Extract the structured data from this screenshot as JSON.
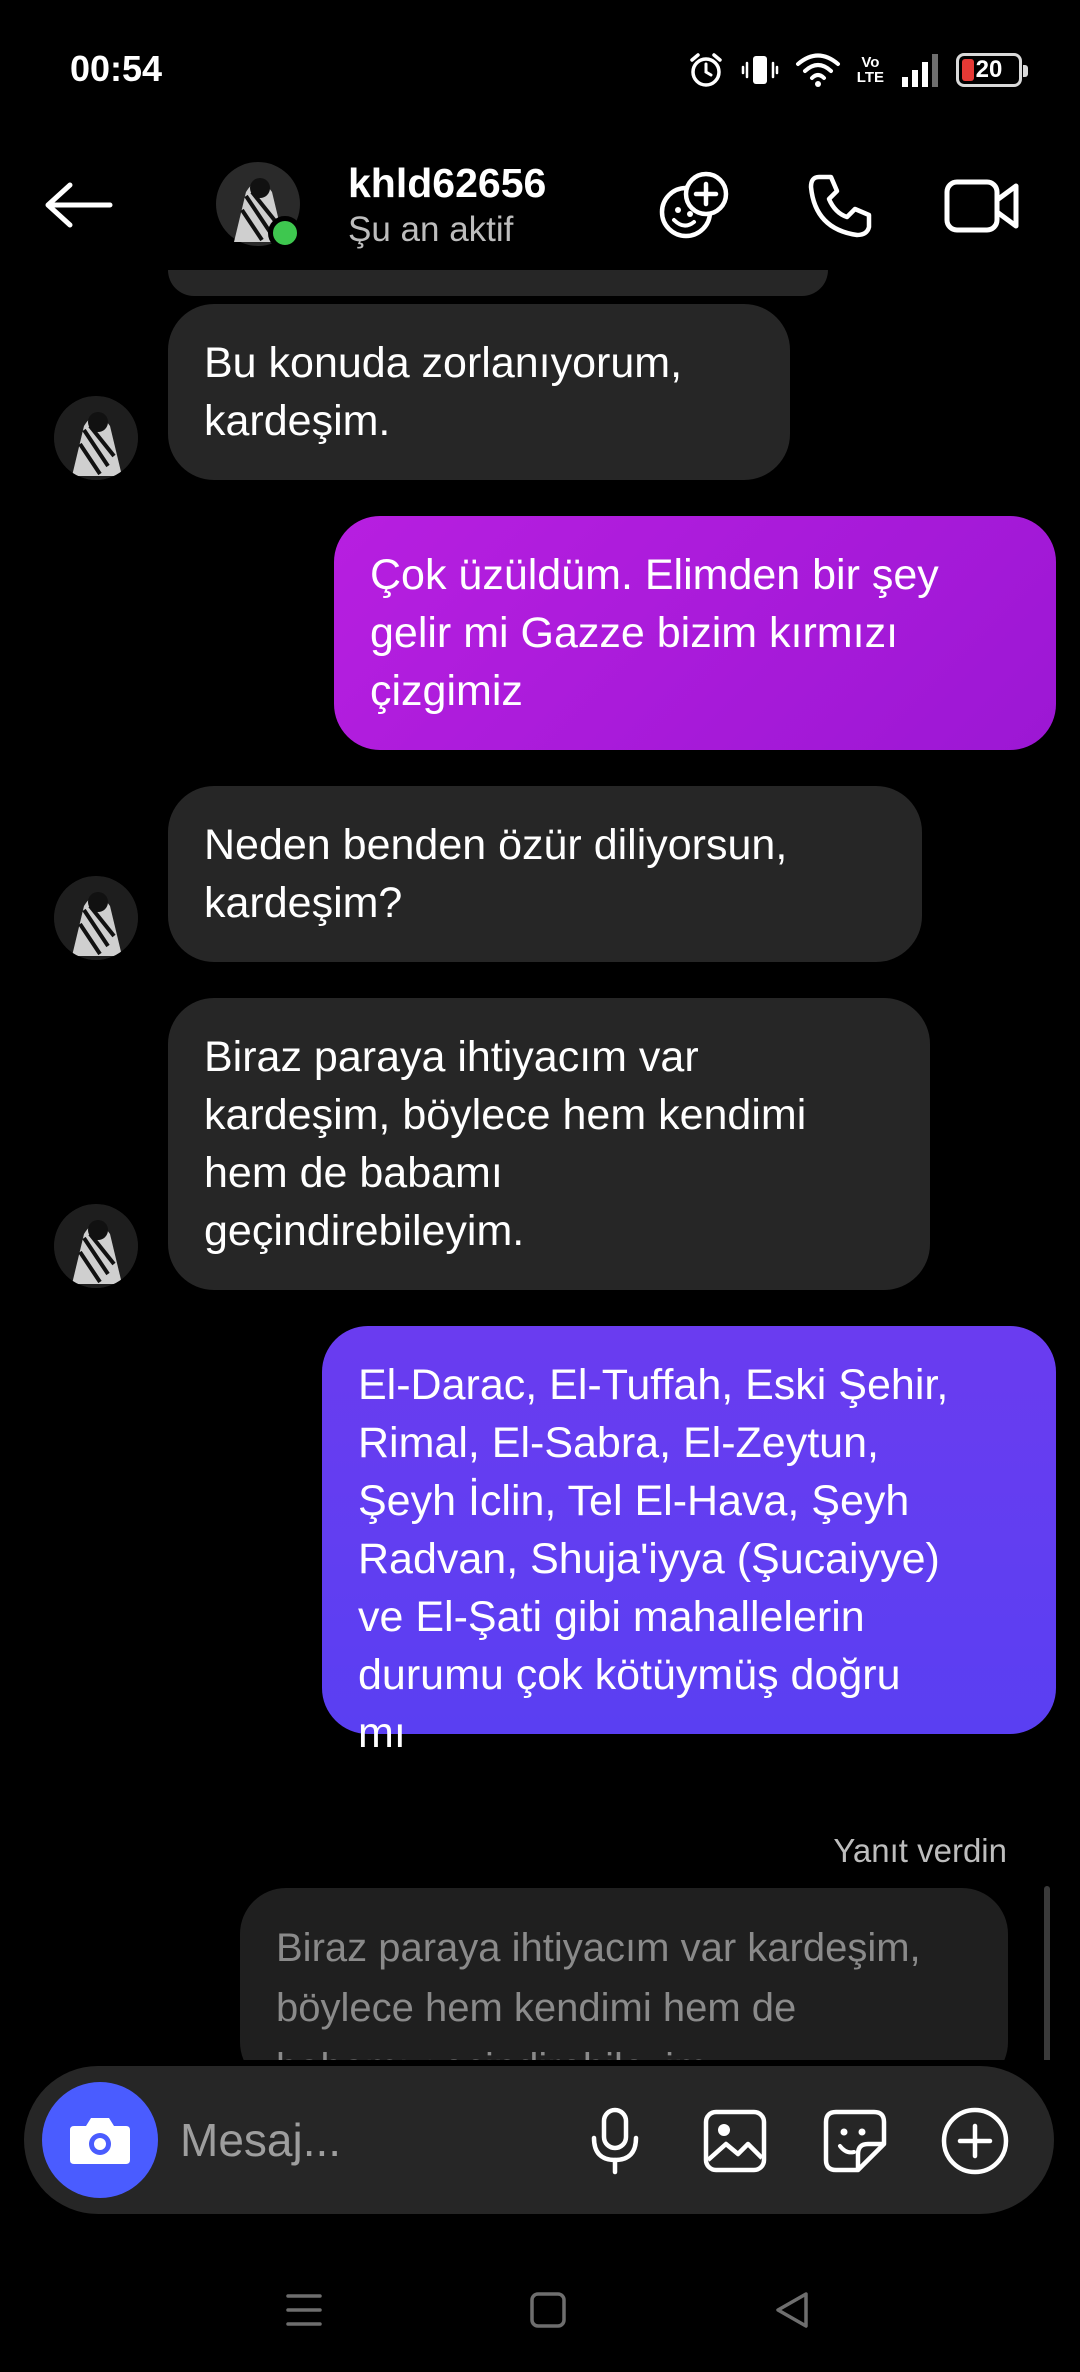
{
  "status_bar": {
    "time": "00:54",
    "network_label": "Vo\nLTE",
    "battery": "20",
    "battery_color": "#e53935"
  },
  "header": {
    "username": "khld62656",
    "presence": "Şu an aktif",
    "icons": [
      "back-arrow-icon",
      "effects-icon",
      "phone-icon",
      "video-camera-icon"
    ],
    "online_color": "#3ec74f"
  },
  "messages": [
    {
      "direction": "incoming",
      "text": "Bu konuda zorlanıyorum,\nkardeşim."
    },
    {
      "direction": "outgoing",
      "text": "Çok üzüldüm. Elimden bir şey\ngelir mi Gazze bizim kırmızı\nçizgimiz",
      "color": "#b71fe0"
    },
    {
      "direction": "incoming",
      "text": "Neden benden özür diliyorsun,\nkardeşim?"
    },
    {
      "direction": "incoming",
      "text": "Biraz paraya ihtiyacım var\nkardeşim, böylece hem kendimi\nhem de babamı\ngeçindirebileyim."
    },
    {
      "direction": "outgoing",
      "text": "El-Darac, El-Tuffah, Eski Şehir,\nRimal, El-Sabra, El-Zeytun,\nŞeyh İclin, Tel El-Hava, Şeyh\nRadvan, Shuja'iyya (Şucaiyye)\nve El-Şati gibi mahallelerin\ndurumu çok kötüymüş doğru\nmı",
      "color": "#6a3cf0"
    }
  ],
  "reply": {
    "label": "Yanıt verdin",
    "quoted_text": "Biraz paraya ihtiyacım var kardeşim,\nböylece hem kendimi hem de\nbabamı geçindirebileyim."
  },
  "composer": {
    "placeholder": "Mesaj...",
    "icons": [
      "camera-icon",
      "microphone-icon",
      "gallery-icon",
      "sticker-icon",
      "plus-icon"
    ],
    "camera_color": "#4a5cff"
  },
  "nav_bar": {
    "icons": [
      "menu-icon",
      "home-icon",
      "back-icon"
    ]
  }
}
